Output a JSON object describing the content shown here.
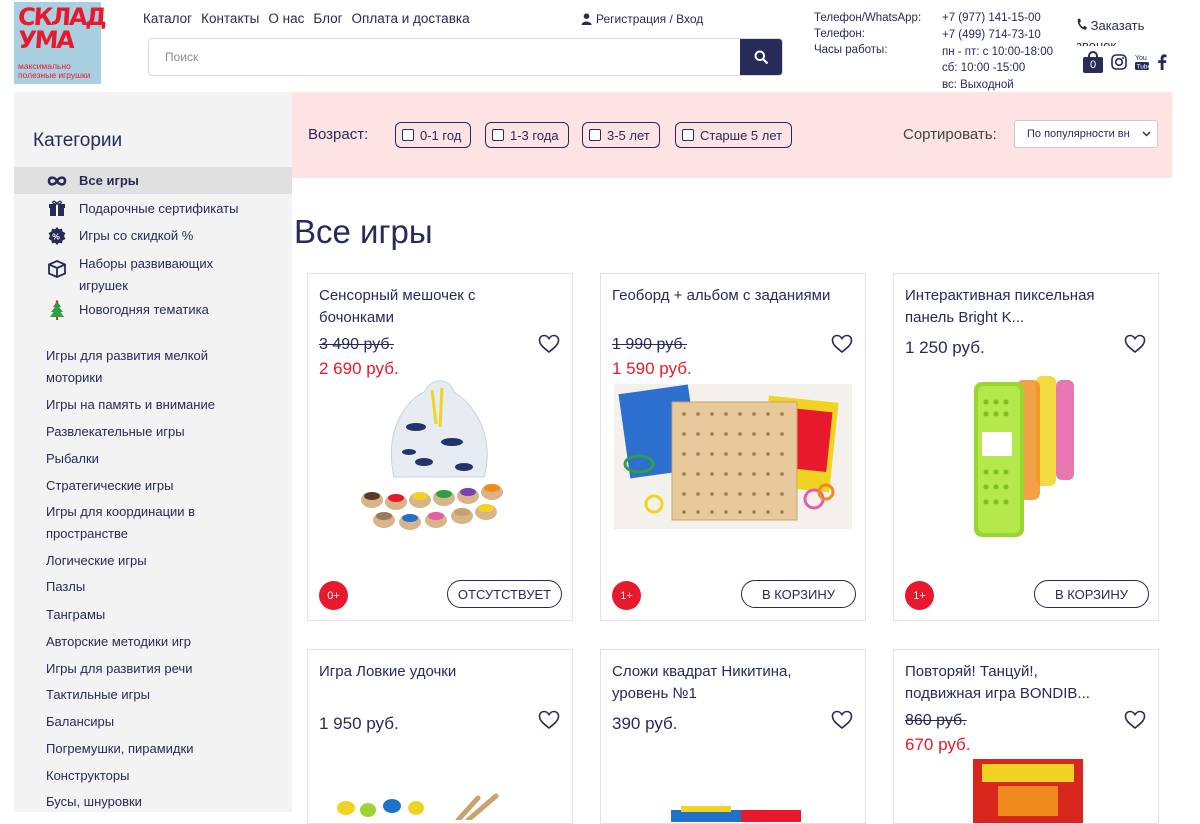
{
  "logo": {
    "line1": "СКЛАД",
    "line2": "УМА",
    "tagline": "максимально полезные игрушки"
  },
  "nav": [
    "Каталог",
    "Контакты",
    "О нас",
    "Блог",
    "Оплата и доставка"
  ],
  "auth": {
    "label": "Регистрация / Вход"
  },
  "search": {
    "placeholder": "Поиск",
    "value": ""
  },
  "contacts": {
    "labels": [
      "Телефон/WhatsApp:",
      "Телефон:",
      "Часы работы:"
    ],
    "values": [
      "+7 (977) 141-15-00",
      "+7 (499) 714-73-10",
      "пн - пт: с 10:00-18:00",
      "сб: 10:00 -15:00",
      "вс: Выходной"
    ],
    "callback": "Заказать звонок",
    "cart_count": "0"
  },
  "colors": {
    "brand": "#262b5a",
    "accent": "#e8192c",
    "filter_bg": "#fde3e3",
    "sidebar_bg": "#f3f3f3"
  },
  "sidebar": {
    "title": "Категории",
    "special": [
      {
        "label": "Все игры",
        "icon": "infinity-icon",
        "active": true
      },
      {
        "label": "Подарочные сертификаты",
        "icon": "gift-icon"
      },
      {
        "label": "Игры со скидкой %",
        "icon": "discount-badge-icon"
      },
      {
        "label": "Наборы развивающих игрушек",
        "icon": "box-icon"
      },
      {
        "label": "Новогодняя тематика",
        "icon": "christmas-tree-icon"
      }
    ],
    "items": [
      "Игры для развития мелкой моторики",
      "Игры на память и внимание",
      "Развлекательные игры",
      "Рыбалки",
      "Стратегические игры",
      "Игры для координации в пространстве",
      "Логические игры",
      "Пазлы",
      "Танграмы",
      "Авторские методики игр",
      "Игры для развития речи",
      "Тактильные игры",
      "Балансиры",
      "Погремушки, пирамидки",
      "Конструкторы",
      "Бусы, шнуровки"
    ]
  },
  "filter": {
    "age_label": "Возраст:",
    "ages": [
      "0-1 год",
      "1-3 года",
      "3-5 лет",
      "Старше 5 лет"
    ],
    "sort_label": "Сортировать:",
    "sort_value": "По популярности вн"
  },
  "page_title": "Все игры",
  "products": [
    {
      "title": "Сенсорный мешочек с бочонками",
      "old_price": "3 490 руб.",
      "price": "2 690 руб.",
      "age": "0+",
      "action": "ОТСУТСТВУЕТ"
    },
    {
      "title": "Геоборд + альбом с заданиями",
      "old_price": "1 990 руб.",
      "price": "1 590 руб.",
      "age": "1+",
      "action": "В КОРЗИНУ"
    },
    {
      "title": "Интерактивная пиксельная панель Bright K...",
      "old_price": "",
      "price": "1 250 руб.",
      "age": "1+",
      "action": "В КОРЗИНУ"
    },
    {
      "title": "Игра Ловкие удочки",
      "old_price": "",
      "price": "1 950 руб."
    },
    {
      "title": "Сложи квадрат Никитина, уровень №1",
      "old_price": "",
      "price": "390 руб."
    },
    {
      "title": "Повторяй! Танцуй!, подвижная игра BONDIB...",
      "old_price": "860 руб.",
      "price": "670 руб."
    }
  ]
}
